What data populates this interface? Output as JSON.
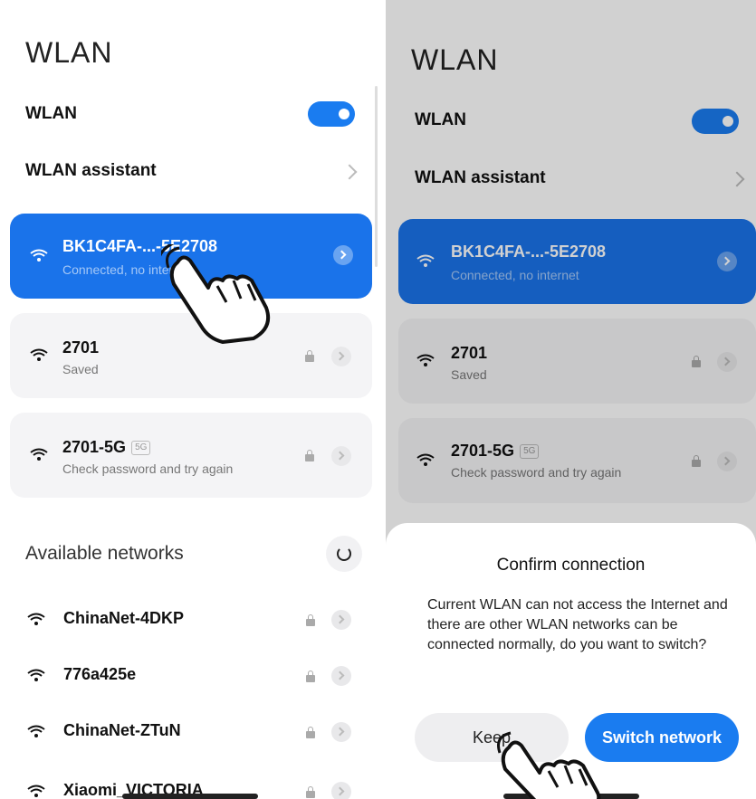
{
  "left": {
    "title": "WLAN",
    "wlan_label": "WLAN",
    "wlan_on": true,
    "assistant_label": "WLAN assistant",
    "connected": {
      "ssid": "BK1C4FA-...-5E2708",
      "status": "Connected, no internet"
    },
    "saved": [
      {
        "ssid": "2701",
        "badge": "",
        "status": "Saved"
      },
      {
        "ssid": "2701-5G",
        "badge": "5G",
        "status": "Check password and try again"
      }
    ],
    "available_title": "Available networks",
    "available": [
      {
        "ssid": "ChinaNet-4DKP"
      },
      {
        "ssid": "776a425e"
      },
      {
        "ssid": "ChinaNet-ZTuN"
      },
      {
        "ssid": "Xiaomi_VICTORIA"
      }
    ]
  },
  "right": {
    "title": "WLAN",
    "wlan_label": "WLAN",
    "assistant_label": "WLAN assistant",
    "connected": {
      "ssid": "BK1C4FA-...-5E2708",
      "status": "Connected, no internet"
    },
    "saved": [
      {
        "ssid": "2701",
        "badge": "",
        "status": "Saved"
      },
      {
        "ssid": "2701-5G",
        "badge": "5G",
        "status": "Check password and try again"
      }
    ],
    "dialog": {
      "title": "Confirm connection",
      "message": "Current WLAN can not access the Internet and there are other WLAN networks can be connected normally, do you want to switch?",
      "keep_label": "Keep",
      "switch_label": "Switch network"
    }
  },
  "colors": {
    "accent": "#1a7cf0",
    "card": "#f4f4f6"
  },
  "icons": [
    "wifi-icon",
    "lock-icon",
    "chevron-right-icon",
    "refresh-icon",
    "hand-pointer-icon"
  ]
}
